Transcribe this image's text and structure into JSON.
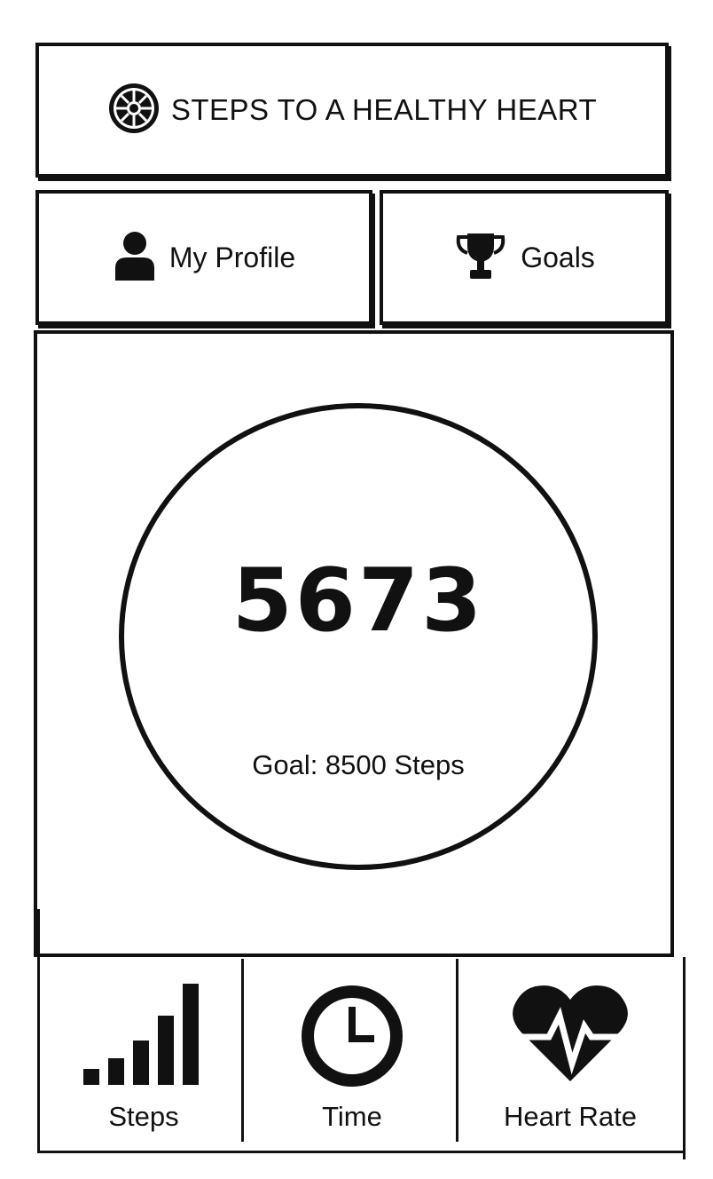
{
  "header": {
    "title": "STEPS TO A HEALTHY HEART",
    "logo_icon": "imperial-emblem-icon"
  },
  "nav": {
    "profile_label": "My Profile",
    "profile_icon": "user-icon",
    "goals_label": "Goals",
    "goals_icon": "trophy-icon"
  },
  "main": {
    "step_count": "5673",
    "goal_text": "Goal: 8500 Steps"
  },
  "tabs": [
    {
      "label": "Steps",
      "icon": "bar-chart-icon"
    },
    {
      "label": "Time",
      "icon": "clock-icon"
    },
    {
      "label": "Heart Rate",
      "icon": "heart-rate-icon"
    }
  ],
  "colors": {
    "ink": "#111111",
    "paper": "#ffffff"
  }
}
